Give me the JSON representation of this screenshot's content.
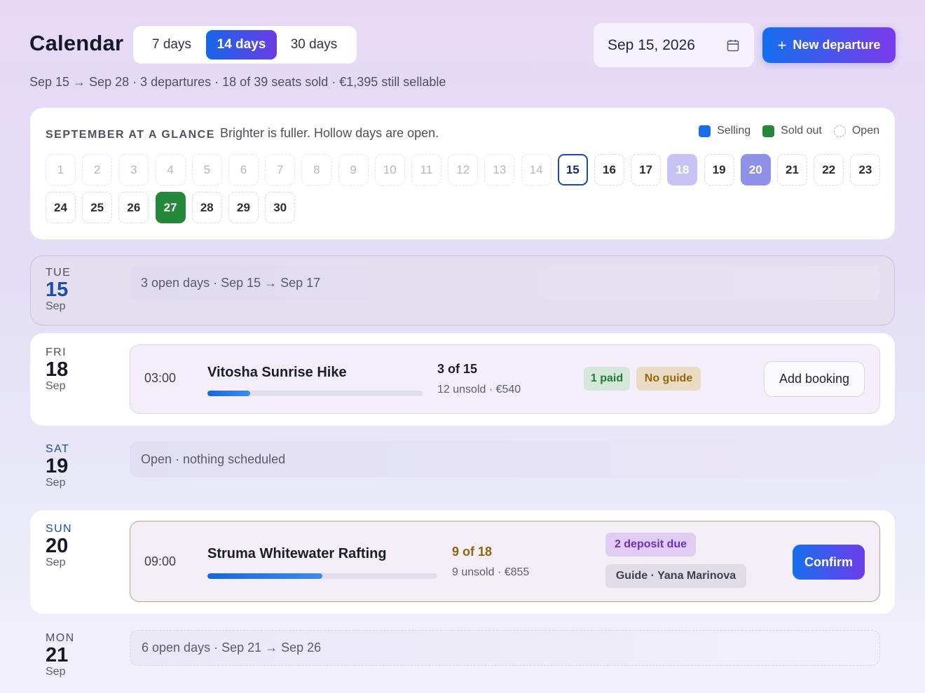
{
  "header": {
    "title": "Calendar",
    "range_options": [
      "7 days",
      "14 days",
      "30 days"
    ],
    "selected_range": "14 days",
    "date_value": "Sep 15, 2026",
    "new_departure_label": "New departure",
    "summary": "Sep 15 → Sep 28 · 3 departures · 18 of 39 seats sold · €1,395 still sellable"
  },
  "glance": {
    "title": "SEPTEMBER AT A GLANCE",
    "subtitle": "Brighter is fuller. Hollow days are open.",
    "legend": [
      "Selling",
      "Sold out",
      "Open"
    ],
    "colors": {
      "selling": "#1a6fe7",
      "sold_out": "#24883b",
      "today_border": "#1a4ba8"
    },
    "days": [
      "1",
      "2",
      "3",
      "4",
      "5",
      "6",
      "7",
      "8",
      "9",
      "10",
      "11",
      "12",
      "13",
      "14",
      "15",
      "16",
      "17",
      "18",
      "19",
      "20",
      "21",
      "22",
      "23",
      "24",
      "25",
      "26",
      "27",
      "28",
      "29",
      "30"
    ],
    "today": "15",
    "selling_days": [
      "18",
      "20"
    ],
    "sold_out_days": [
      "27"
    ]
  },
  "rows": {
    "d15": {
      "dow": "TUE",
      "dom": "15",
      "mon": "Sep",
      "text": "3 open days · Sep 15 → Sep 17"
    },
    "d18": {
      "dow": "FRI",
      "dom": "18",
      "mon": "Sep",
      "time": "03:00",
      "name": "Vitosha Sunrise Hike",
      "seats": "3 of 15",
      "unsold": "12 unsold · €540",
      "fill": 0.2,
      "badges": [
        "1 paid",
        "No guide"
      ],
      "action": "Add booking"
    },
    "d19": {
      "dow": "SAT",
      "dom": "19",
      "mon": "Sep",
      "text": "Open · nothing scheduled"
    },
    "d20": {
      "dow": "SUN",
      "dom": "20",
      "mon": "Sep",
      "time": "09:00",
      "name": "Struma Whitewater Rafting",
      "seats": "9 of 18",
      "unsold": "9 unsold · €855",
      "fill": 0.5,
      "badges": [
        "2 deposit due",
        "Guide · Yana Marinova"
      ],
      "action": "Confirm"
    },
    "d21": {
      "dow": "MON",
      "dom": "21",
      "mon": "Sep",
      "text": "6 open days · Sep 21 → Sep 26"
    }
  }
}
